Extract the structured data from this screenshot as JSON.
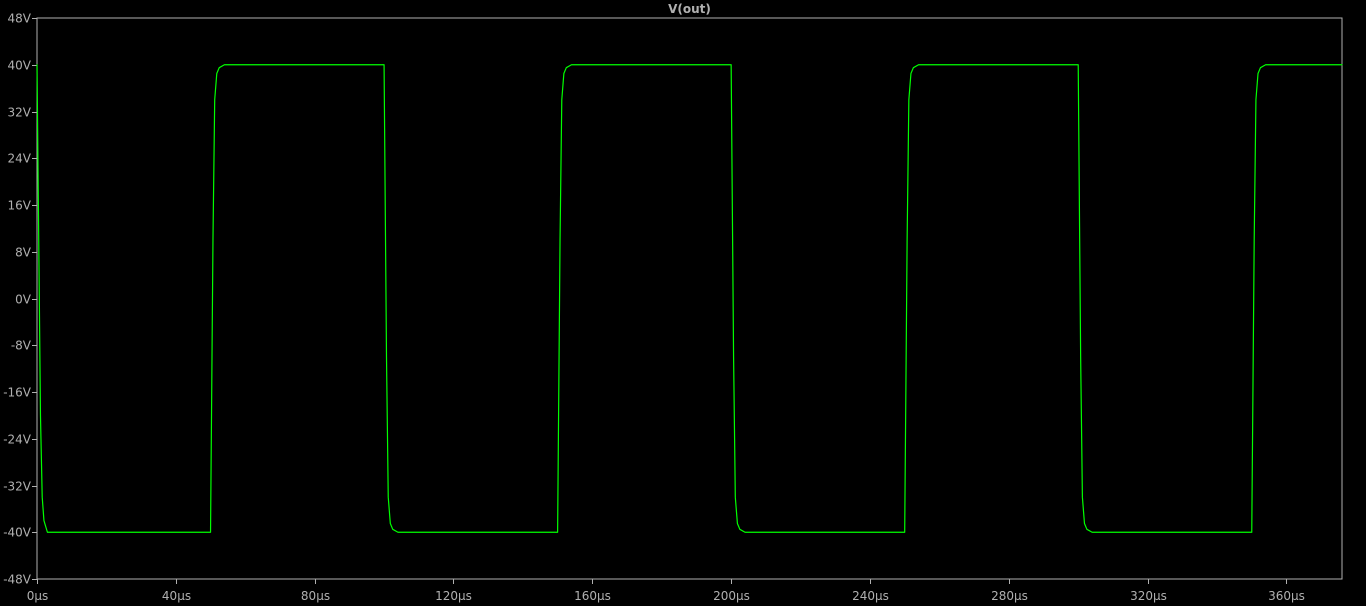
{
  "chart_data": {
    "type": "line",
    "title": "V(out)",
    "xlabel": "",
    "ylabel": "",
    "xlim": [
      0,
      376
    ],
    "ylim": [
      -48,
      48
    ],
    "x_unit": "µs",
    "y_unit": "V",
    "x_ticks": [
      0,
      40,
      80,
      120,
      160,
      200,
      240,
      280,
      320,
      360
    ],
    "y_ticks": [
      48,
      40,
      32,
      24,
      16,
      8,
      0,
      -8,
      -16,
      -24,
      -32,
      -40,
      -48
    ],
    "x_tick_labels": [
      "0µs",
      "40µs",
      "80µs",
      "120µs",
      "160µs",
      "200µs",
      "240µs",
      "280µs",
      "320µs",
      "360µs"
    ],
    "y_tick_labels": [
      "48V",
      "40V",
      "32V",
      "24V",
      "16V",
      "8V",
      "0V",
      "-8V",
      "-16V",
      "-24V",
      "-32V",
      "-40V",
      "-48V"
    ],
    "grid": false,
    "series": [
      {
        "name": "V(out)",
        "color": "#00ff00",
        "x": [
          0,
          0.5,
          1,
          1.5,
          2,
          3,
          50,
          50.7,
          51.2,
          51.8,
          52.5,
          54,
          100,
          100.7,
          101.2,
          101.8,
          102.5,
          104,
          150,
          150.7,
          151.2,
          151.8,
          152.5,
          154,
          200,
          200.7,
          201.2,
          201.8,
          202.5,
          204,
          250,
          250.7,
          251.2,
          251.8,
          252.5,
          254,
          300,
          300.7,
          301.2,
          301.8,
          302.5,
          304,
          350,
          350.7,
          351.2,
          351.8,
          352.5,
          354,
          376
        ],
        "values": [
          40,
          10,
          -20,
          -34,
          -38,
          -40,
          -40,
          10,
          34,
          38.5,
          39.5,
          40,
          40,
          -10,
          -34,
          -38.5,
          -39.5,
          -40,
          -40,
          10,
          34,
          38.5,
          39.5,
          40,
          40,
          -10,
          -34,
          -38.5,
          -39.5,
          -40,
          -40,
          10,
          34,
          38.5,
          39.5,
          40,
          40,
          -10,
          -34,
          -38.5,
          -39.5,
          -40,
          -40,
          10,
          34,
          38.5,
          39.5,
          40,
          40
        ]
      }
    ]
  },
  "colors": {
    "background": "#000000",
    "axis": "#b0b0b0",
    "trace": "#00ff00"
  }
}
